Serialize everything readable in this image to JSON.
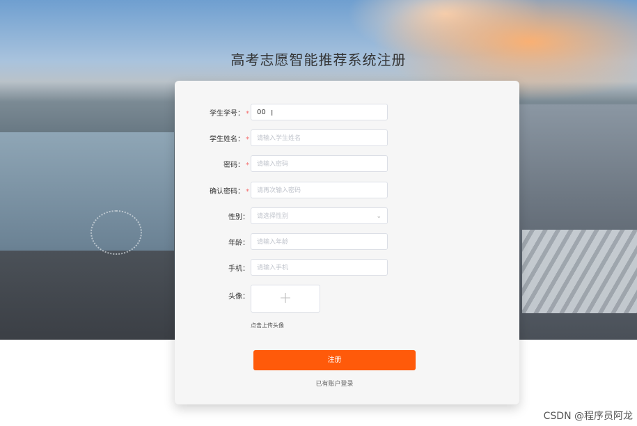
{
  "title": "高考志愿智能推荐系统注册",
  "form": {
    "student_id": {
      "label": "学生学号：",
      "required": true,
      "value": "00",
      "placeholder": ""
    },
    "student_name": {
      "label": "学生姓名：",
      "required": true,
      "placeholder": "请输入学生姓名"
    },
    "password": {
      "label": "密码：",
      "required": true,
      "placeholder": "请输入密码"
    },
    "confirm_password": {
      "label": "确认密码：",
      "required": true,
      "placeholder": "请再次输入密码"
    },
    "gender": {
      "label": "性别：",
      "placeholder": "请选择性别"
    },
    "age": {
      "label": "年龄：",
      "placeholder": "请输入年龄"
    },
    "phone": {
      "label": "手机：",
      "placeholder": "请输入手机"
    },
    "avatar": {
      "label": "头像：",
      "hint": "点击上传头像"
    },
    "required_mark": "*"
  },
  "actions": {
    "register": "注册",
    "login_link": "已有账户登录"
  },
  "watermark": "CSDN @程序员阿龙",
  "colors": {
    "primary": "#ff5a0a",
    "required": "#f56c6c"
  }
}
